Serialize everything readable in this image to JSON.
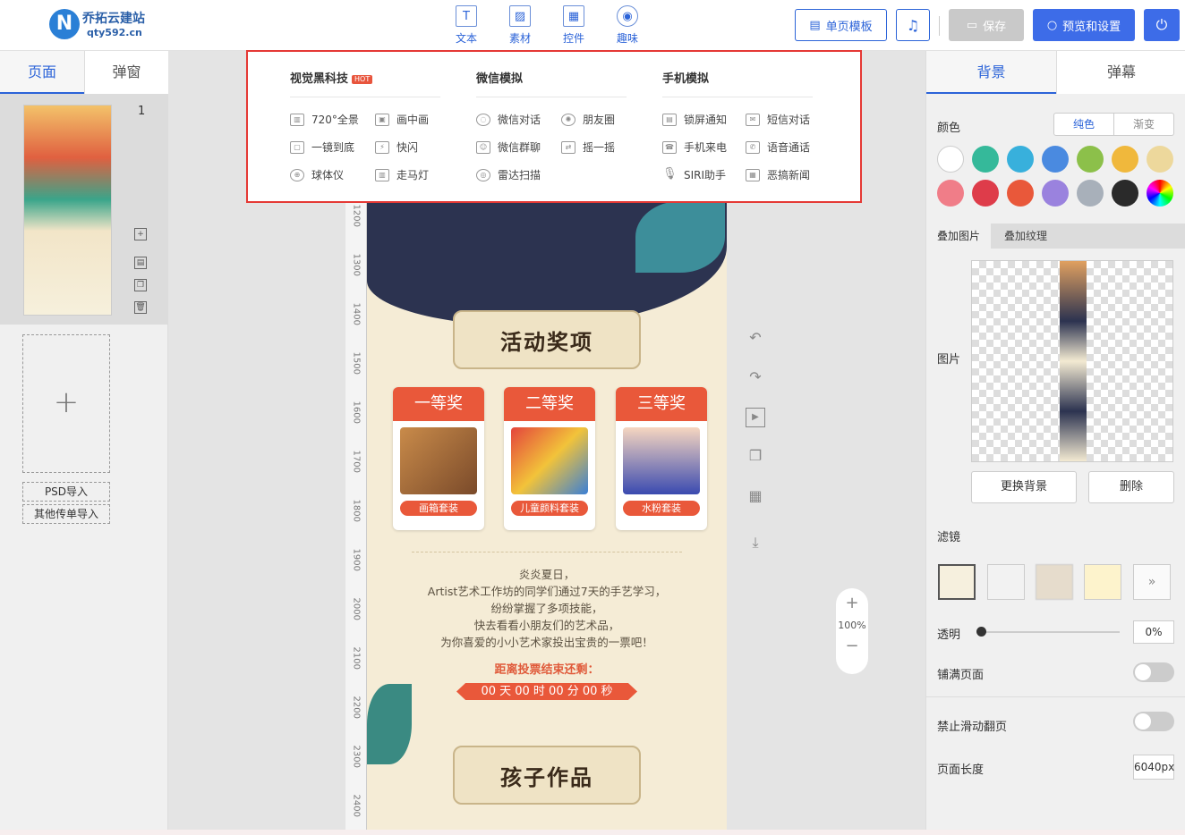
{
  "logo": {
    "title": "乔拓云建站",
    "url": "qty592.cn"
  },
  "toolbar": {
    "tools": [
      {
        "label": "文本",
        "icon": "T"
      },
      {
        "label": "素材",
        "icon": "▨"
      },
      {
        "label": "控件",
        "icon": "▦"
      },
      {
        "label": "趣味",
        "icon": "◉"
      }
    ],
    "template_btn": "单页模板",
    "save_btn": "保存",
    "preview_btn": "预览和设置"
  },
  "left": {
    "tabs": [
      "页面",
      "弹窗"
    ],
    "page_number": "1",
    "psd_import": "PSD导入",
    "other_import": "其他传单导入"
  },
  "ruler": [
    "1200",
    "1300",
    "1400",
    "1500",
    "1600",
    "1700",
    "1800",
    "1900",
    "2000",
    "2100",
    "2200",
    "2300",
    "2400"
  ],
  "canvas": {
    "banner1": "活动奖项",
    "prizes": [
      {
        "rank": "一等奖",
        "name": "画箱套装"
      },
      {
        "rank": "二等奖",
        "name": "儿童颜料套装"
      },
      {
        "rank": "三等奖",
        "name": "水粉套装"
      }
    ],
    "desc": [
      "炎炎夏日，",
      "Artist艺术工作坊的同学们通过7天的手艺学习，",
      "纷纷掌握了多项技能，",
      "快去看看小朋友们的艺术品，",
      "为你喜爱的小小艺术家投出宝贵的一票吧！"
    ],
    "countdown_label": "距离投票结束还剩：",
    "countdown": "00 天 00 时 00 分 00 秒",
    "banner2": "孩子作品"
  },
  "zoom": "100%",
  "dropdown": {
    "columns": [
      {
        "title": "视觉黑科技",
        "hot": "HOT",
        "items": [
          {
            "label": "720°全景",
            "icon": "panorama"
          },
          {
            "label": "画中画",
            "icon": "pip"
          },
          {
            "label": "一镜到底",
            "icon": "one-shot"
          },
          {
            "label": "快闪",
            "icon": "flash"
          },
          {
            "label": "球体仪",
            "icon": "globe"
          },
          {
            "label": "走马灯",
            "icon": "carousel"
          }
        ]
      },
      {
        "title": "微信模拟",
        "items": [
          {
            "label": "微信对话",
            "icon": "chat"
          },
          {
            "label": "朋友圈",
            "icon": "moments"
          },
          {
            "label": "微信群聊",
            "icon": "group"
          },
          {
            "label": "摇一摇",
            "icon": "shake"
          },
          {
            "label": "雷达扫描",
            "icon": "radar"
          }
        ]
      },
      {
        "title": "手机模拟",
        "items": [
          {
            "label": "锁屏通知",
            "icon": "lock-screen"
          },
          {
            "label": "短信对话",
            "icon": "sms"
          },
          {
            "label": "手机来电",
            "icon": "call"
          },
          {
            "label": "语音通话",
            "icon": "voice"
          },
          {
            "label": "SIRI助手",
            "icon": "mic"
          },
          {
            "label": "恶搞新闻",
            "icon": "news"
          }
        ]
      }
    ]
  },
  "right": {
    "tabs": [
      "背景",
      "弹幕"
    ],
    "color_label": "颜色",
    "seg": [
      "纯色",
      "渐变"
    ],
    "colors": [
      "#ffffff",
      "#35b99a",
      "#38b0dc",
      "#4a8ae0",
      "#8cc04a",
      "#f0b83c",
      "#edd89c",
      "#f07d88",
      "#de3c4a",
      "#e9583a",
      "#9a82de",
      "#a8b0ba",
      "#2a2a2a",
      "rainbow"
    ],
    "subtabs": [
      "叠加图片",
      "叠加纹理"
    ],
    "image_label": "图片",
    "replace_btn": "更换背景",
    "delete_btn": "删除",
    "filter_label": "滤镜",
    "opacity_label": "透明",
    "opacity_value": "0%",
    "fill_label": "铺满页面",
    "noscroll_label": "禁止滑动翻页",
    "length_label": "页面长度",
    "length_value": "6040px"
  }
}
